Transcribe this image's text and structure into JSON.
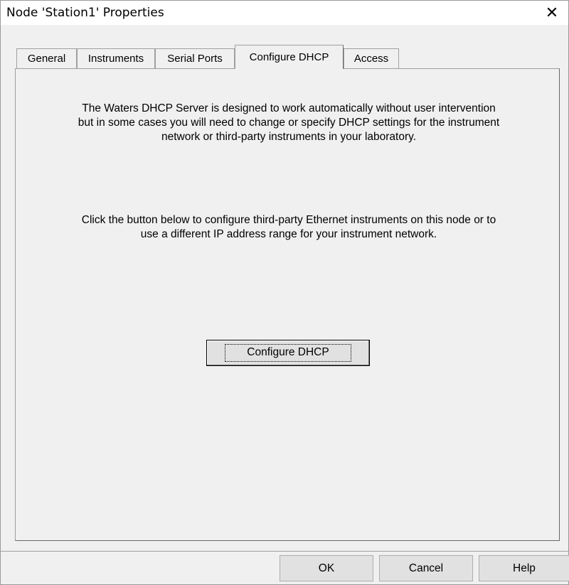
{
  "window": {
    "title": "Node 'Station1' Properties",
    "close_glyph": "✕"
  },
  "tabs": [
    {
      "label": "General",
      "selected": false
    },
    {
      "label": "Instruments",
      "selected": false
    },
    {
      "label": "Serial Ports",
      "selected": false
    },
    {
      "label": "Configure DHCP",
      "selected": true
    },
    {
      "label": "Access",
      "selected": false
    }
  ],
  "panel": {
    "paragraph1": "The Waters DHCP Server is designed to work automatically without user intervention but in some cases you will need to change or specify DHCP settings for the instrument network or third-party instruments in your laboratory.",
    "paragraph2": "Click the button below to configure third-party Ethernet instruments on this node or to use a different IP address range for your instrument network.",
    "configure_button": "Configure DHCP"
  },
  "footer": {
    "ok": "OK",
    "cancel": "Cancel",
    "help": "Help"
  }
}
